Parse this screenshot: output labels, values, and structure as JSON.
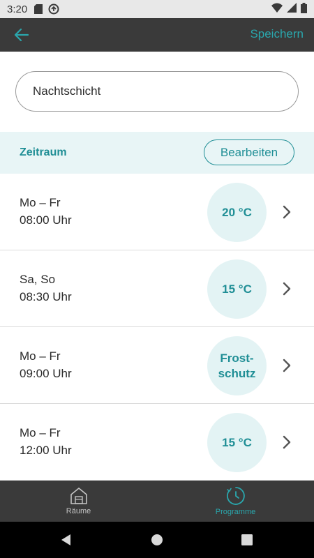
{
  "status_bar": {
    "time": "3:20",
    "icons_left": [
      "sd-card-icon",
      "sync-icon"
    ],
    "icons_right": [
      "wifi-icon",
      "cellular-signal-icon",
      "battery-icon"
    ]
  },
  "app_bar": {
    "back_icon": "arrow-left-icon",
    "save_label": "Speichern"
  },
  "program": {
    "name_value": "Nachtschicht"
  },
  "section": {
    "title": "Zeitraum",
    "edit_label": "Bearbeiten"
  },
  "schedule": [
    {
      "days": "Mo – Fr",
      "time": "08:00 Uhr",
      "temp": "20 °C"
    },
    {
      "days": "Sa, So",
      "time": "08:30 Uhr",
      "temp": "15 °C"
    },
    {
      "days": "Mo – Fr",
      "time": "09:00 Uhr",
      "temp": "Frost-\nschutz"
    },
    {
      "days": "Mo – Fr",
      "time": "12:00 Uhr",
      "temp": "15 °C"
    }
  ],
  "bottom_nav": {
    "rooms_label": "Räume",
    "programs_label": "Programme",
    "active": "programs"
  },
  "colors": {
    "accent": "#2aa7ad",
    "accent_dark": "#1f8e95",
    "bar_dark": "#3a3a3a",
    "temp_bubble": "#e3f3f4",
    "section_bg": "#e8f5f6"
  }
}
